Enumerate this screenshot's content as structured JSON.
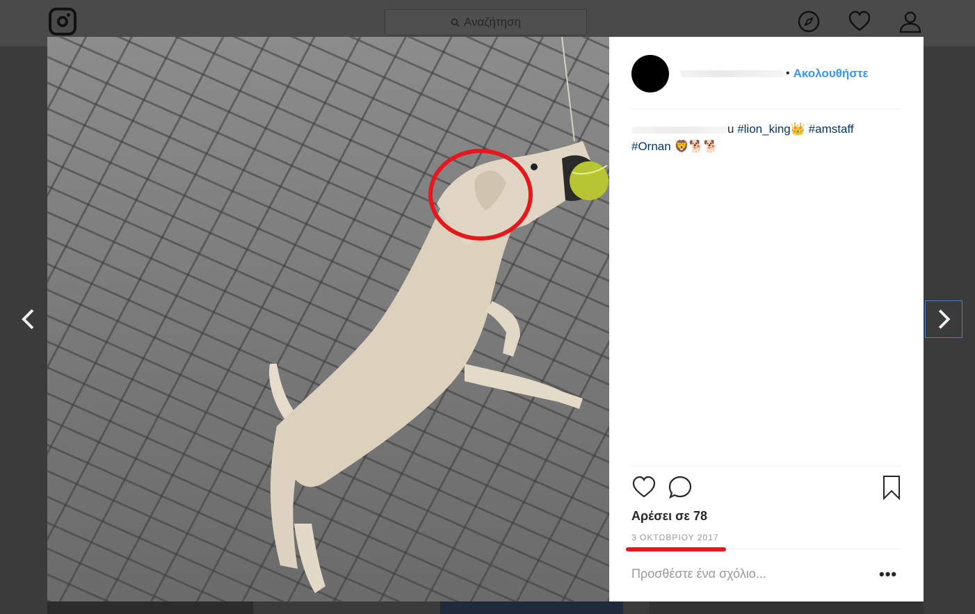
{
  "nav": {
    "search_placeholder": "Αναζήτηση",
    "icons": [
      "instagram-logo",
      "compass-icon",
      "heart-icon",
      "user-icon"
    ]
  },
  "post": {
    "follow_label": "Ακολουθήστε",
    "dot": "•",
    "caption": {
      "username_tail": "u",
      "tags": [
        "#lion_king",
        "#amstaff",
        "#Ornan"
      ],
      "emoji_line1": "👑",
      "emoji_line2": "🦁🐕🐕"
    },
    "likes": "Αρέσει σε 78",
    "date": "3 ΟΚΤΩΒΡΙΟΥ 2017",
    "comment_placeholder": "Προσθέστε ένα σχόλιο...",
    "more_label": "•••"
  },
  "colors": {
    "accent": "#3897f0",
    "annotation_red": "#e5181e",
    "hashtag": "#003569"
  }
}
